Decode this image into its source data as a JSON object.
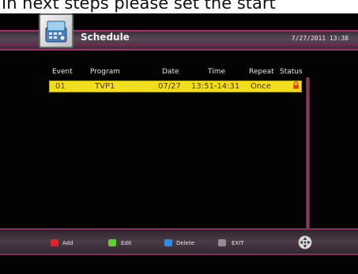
{
  "caption": "In next steps please set the start",
  "header": {
    "title": "Schedule",
    "datetime": "7/27/2011 13:38"
  },
  "columns": {
    "event": "Event",
    "program": "Program",
    "date": "Date",
    "time": "Time",
    "repeat": "Repeat",
    "status": "Status"
  },
  "rows": [
    {
      "event": "01",
      "program": "TVP1",
      "date": "07/27",
      "time": "13:51-14:31",
      "repeat": "Once",
      "status_icon": "lock-icon"
    }
  ],
  "footer": {
    "keys": [
      {
        "label": "Add",
        "color": "#e8202a"
      },
      {
        "label": "Edit",
        "color": "#5cd22a"
      },
      {
        "label": "Delete",
        "color": "#2a8ee8"
      },
      {
        "label": "EXIT",
        "color": "#9a8a94"
      }
    ]
  },
  "colors": {
    "accent": "#a4306d",
    "highlight": "#f2de1e"
  }
}
